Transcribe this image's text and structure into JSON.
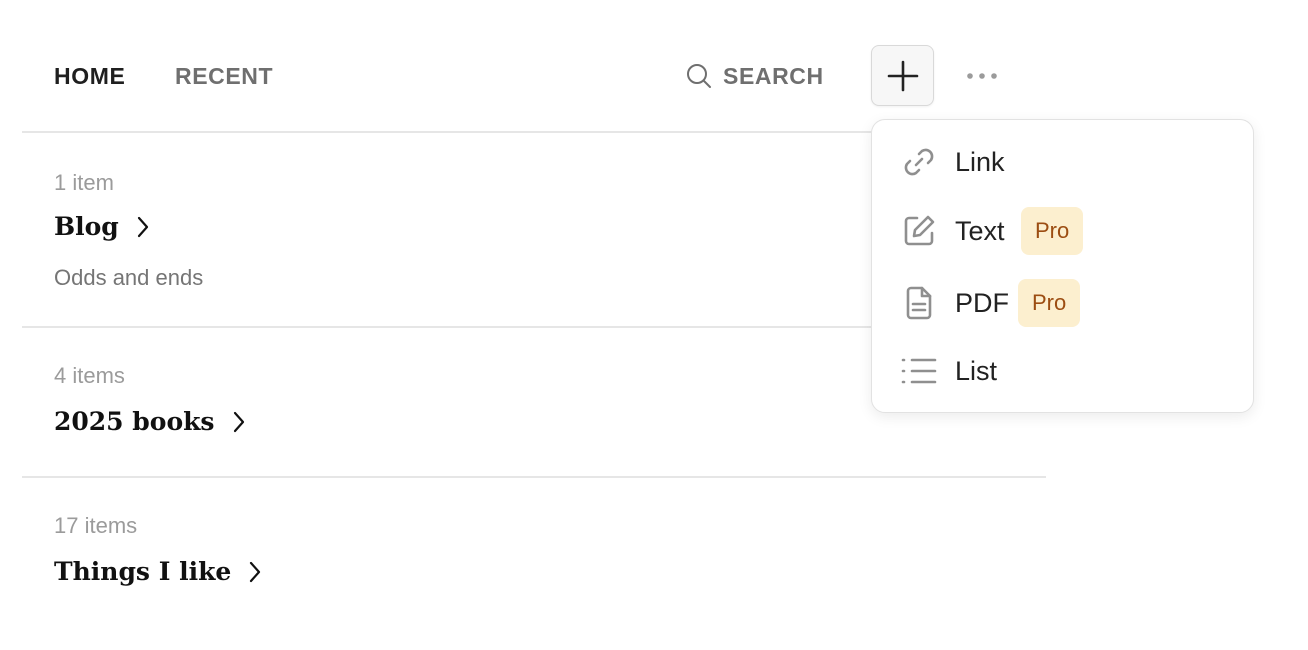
{
  "nav": {
    "home": "HOME",
    "recent": "RECENT",
    "search": "SEARCH"
  },
  "icons": {
    "search": "search-icon",
    "add": "plus-icon",
    "more": "more-horizontal-icon",
    "chevron": "chevron-right-icon",
    "link": "link-icon",
    "text": "edit-icon",
    "pdf": "document-icon",
    "list": "list-icon"
  },
  "collections": [
    {
      "count": "1 item",
      "title": "Blog",
      "description": "Odds and ends"
    },
    {
      "count": "4 items",
      "title": "2025 books"
    },
    {
      "count": "17 items",
      "title": "Things I like"
    }
  ],
  "menu": {
    "items": [
      {
        "label": "Link"
      },
      {
        "label": "Text",
        "badge": "Pro"
      },
      {
        "label": "PDF",
        "badge": "Pro"
      },
      {
        "label": "List"
      }
    ]
  },
  "colors": {
    "badge_bg": "#fcefcf",
    "badge_text": "#9c4d12",
    "muted": "#6f6f6f",
    "divider": "#e6e6e6"
  }
}
